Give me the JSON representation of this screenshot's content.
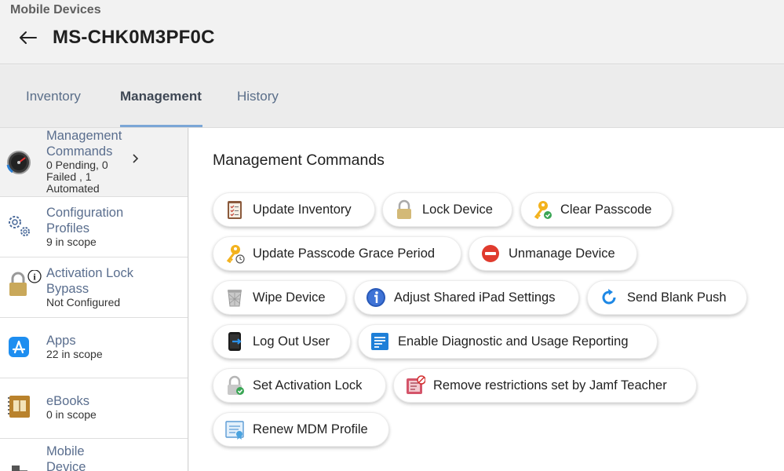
{
  "header": {
    "section": "Mobile Devices",
    "device_name": "MS-CHK0M3PF0C",
    "back_icon": "arrow-left-icon"
  },
  "tabs": [
    {
      "label": "Inventory",
      "active": false
    },
    {
      "label": "Management",
      "active": true
    },
    {
      "label": "History",
      "active": false
    }
  ],
  "sidebar": {
    "items": [
      {
        "title": "Management Commands",
        "subtitle": "0 Pending, 0 Failed , 1 Automated",
        "icon": "speedometer-icon",
        "active": true
      },
      {
        "title": "Configuration Profiles",
        "subtitle": "9 in scope",
        "icon": "gears-icon",
        "active": false
      },
      {
        "title": "Activation Lock Bypass",
        "subtitle": "Not Configured",
        "icon": "padlock-info-icon",
        "active": false
      },
      {
        "title": "Apps",
        "subtitle": "22 in scope",
        "icon": "app-store-icon",
        "active": false
      },
      {
        "title": "eBooks",
        "subtitle": "0 in scope",
        "icon": "book-icon",
        "active": false
      },
      {
        "title": "Mobile Device",
        "subtitle": "",
        "icon": "building-icon",
        "active": false
      }
    ]
  },
  "main": {
    "title": "Management Commands",
    "commands": [
      {
        "label": "Update Inventory",
        "icon": "clipboard-checklist-icon"
      },
      {
        "label": "Lock Device",
        "icon": "padlock-icon"
      },
      {
        "label": "Clear Passcode",
        "icon": "key-check-icon"
      },
      {
        "label": "Update Passcode Grace Period",
        "icon": "key-clock-icon"
      },
      {
        "label": "Unmanage Device",
        "icon": "no-entry-icon"
      },
      {
        "label": "Wipe Device",
        "icon": "trash-can-icon"
      },
      {
        "label": "Adjust Shared iPad Settings",
        "icon": "info-circle-icon"
      },
      {
        "label": "Send Blank Push",
        "icon": "refresh-arrow-icon"
      },
      {
        "label": "Log Out User",
        "icon": "phone-logout-icon"
      },
      {
        "label": "Enable Diagnostic and Usage Reporting",
        "icon": "report-list-icon"
      },
      {
        "label": "Set Activation Lock",
        "icon": "padlock-check-icon"
      },
      {
        "label": "Remove restrictions set by Jamf Teacher",
        "icon": "restriction-remove-icon"
      },
      {
        "label": "Renew MDM Profile",
        "icon": "certificate-icon"
      }
    ]
  },
  "colors": {
    "accent_underline": "#7ba6d6",
    "link_blue": "#5a6e8e"
  }
}
